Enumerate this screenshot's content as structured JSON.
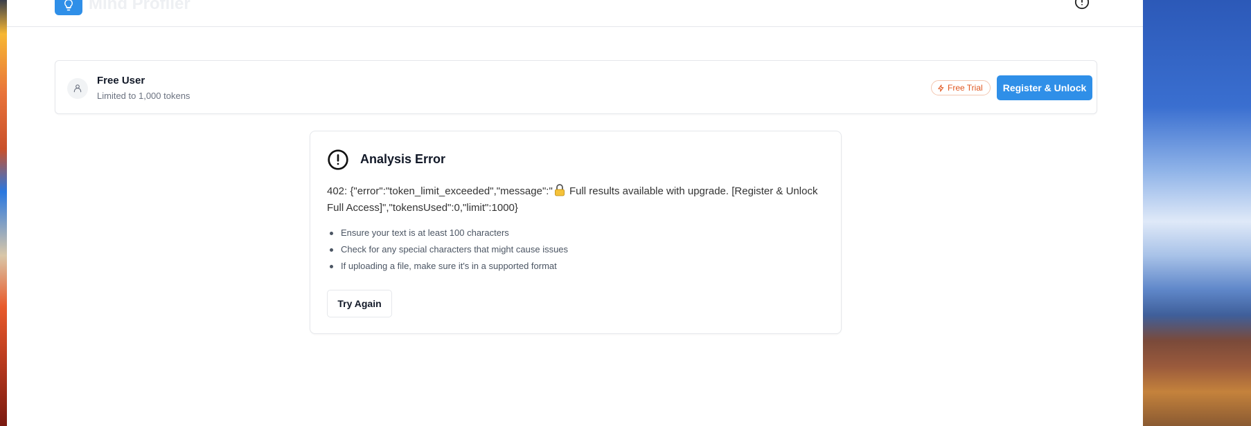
{
  "app": {
    "title": "Mind Profiler"
  },
  "user": {
    "name": "Free User",
    "limit_text": "Limited to 1,000 tokens",
    "trial_badge": "Free Trial",
    "register_label": "Register & Unlock"
  },
  "error": {
    "title": "Analysis Error",
    "message_prefix": "402: {\"error\":\"token_limit_exceeded\",\"message\":\"",
    "message_suffix": " Full results available with upgrade. [Register & Unlock Full Access]\",\"tokensUsed\":0,\"limit\":1000}",
    "tips": [
      "Ensure your text is at least 100 characters",
      "Check for any special characters that might cause issues",
      "If uploading a file, make sure it's in a supported format"
    ],
    "retry_label": "Try Again"
  },
  "icons": {
    "logo": "lightbulb-icon",
    "help": "alert-circle-icon",
    "avatar": "user-icon",
    "trial": "lightning-icon",
    "error": "alert-circle-icon",
    "lock": "lock-emoji"
  },
  "colors": {
    "accent": "#2f8fe8",
    "trial": "#e0561f",
    "lock": "#f5c23a"
  }
}
